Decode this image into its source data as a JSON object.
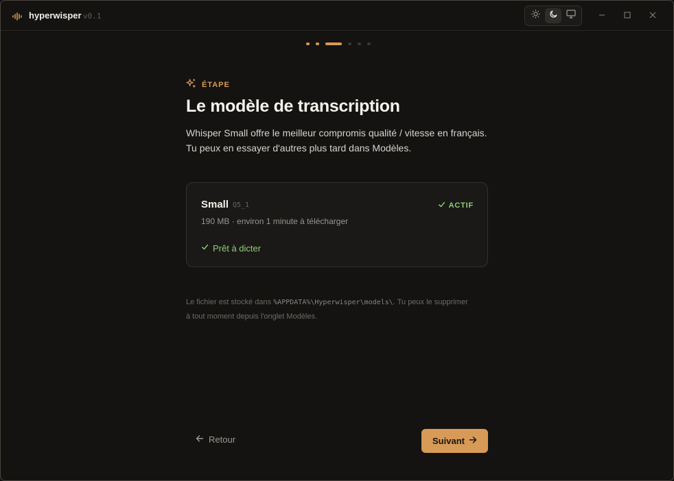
{
  "app": {
    "name": "hyperwisper",
    "version": "v0.1"
  },
  "colors": {
    "accent": "#d79a57",
    "success": "#8fcf74",
    "background": "#141312"
  },
  "theme_switch": {
    "options": [
      "sun-icon",
      "moon-icon",
      "monitor-icon"
    ],
    "selected": "moon-icon"
  },
  "progress": {
    "total_steps": 6,
    "current_step": 3
  },
  "step": {
    "label": "ÉTAPE",
    "title": "Le modèle de transcription",
    "description_line1": "Whisper Small offre le meilleur compromis qualité / vitesse en français.",
    "description_line2": "Tu peux en essayer d'autres plus tard dans Modèles."
  },
  "model_card": {
    "name": "Small",
    "quantization": "Q5_1",
    "status": "ACTIF",
    "info": "190 MB · environ 1 minute à télécharger",
    "ready": "Prêt à dicter"
  },
  "note": {
    "prefix": "Le fichier est stocké dans ",
    "path": "%APPDATA%\\Hyperwisper\\models\\",
    "suffix": ". Tu peux le supprimer",
    "line2": "à tout moment depuis l'onglet Modèles."
  },
  "nav": {
    "back": "Retour",
    "next": "Suivant"
  }
}
